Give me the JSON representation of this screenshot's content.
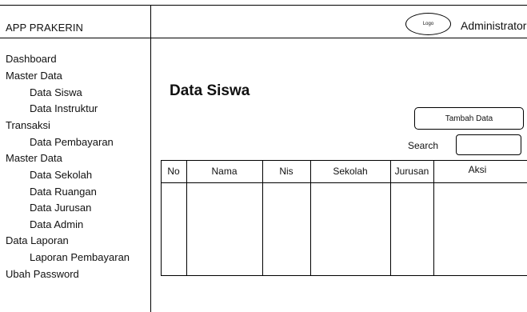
{
  "header": {
    "app_title": "APP PRAKERIN",
    "logo_text": "Logo",
    "user_label": "Administrator"
  },
  "sidebar": {
    "items": [
      {
        "label": "Dashboard"
      },
      {
        "label": "Master Data"
      },
      {
        "label": "Data Siswa"
      },
      {
        "label": "Data Instruktur"
      },
      {
        "label": "Transaksi"
      },
      {
        "label": "Data Pembayaran"
      },
      {
        "label": "Master Data"
      },
      {
        "label": "Data Sekolah"
      },
      {
        "label": "Data Ruangan"
      },
      {
        "label": "Data Jurusan"
      },
      {
        "label": "Data Admin"
      },
      {
        "label": "Data Laporan"
      },
      {
        "label": "Laporan Pembayaran"
      },
      {
        "label": "Ubah Password"
      }
    ]
  },
  "main": {
    "title": "Data Siswa",
    "add_button_label": "Tambah Data",
    "search_label": "Search",
    "search_value": "",
    "table": {
      "columns": [
        "No",
        "Nama",
        "Nis",
        "Sekolah",
        "Jurusan",
        "Aksi"
      ],
      "rows": []
    }
  }
}
